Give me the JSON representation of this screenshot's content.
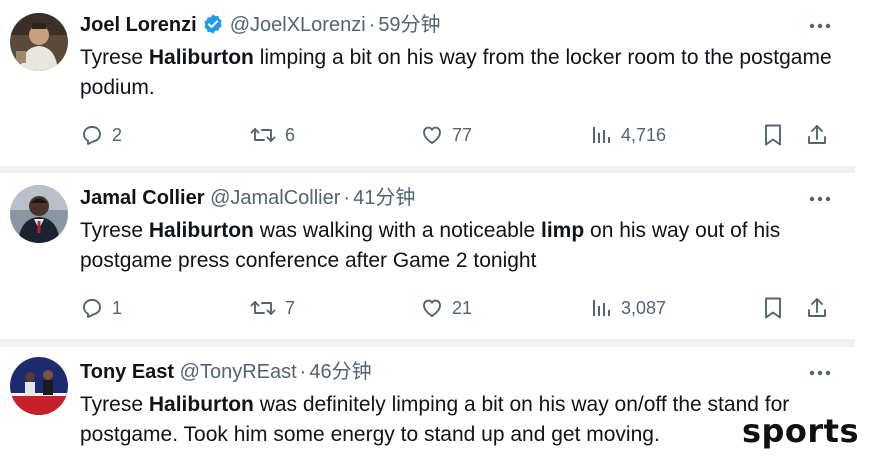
{
  "tweets": [
    {
      "name": "Joel Lorenzi",
      "verified": true,
      "handle": "@JoelXLorenzi",
      "separator": "·",
      "time": "59分钟",
      "text_parts": [
        {
          "t": "Tyrese ",
          "b": false
        },
        {
          "t": "Haliburton",
          "b": true
        },
        {
          "t": " limping a bit on his way from the locker room to the postgame podium.",
          "b": false
        }
      ],
      "replies": "2",
      "retweets": "6",
      "likes": "77",
      "views": "4,716"
    },
    {
      "name": "Jamal Collier",
      "verified": false,
      "handle": "@JamalCollier",
      "separator": "·",
      "time": "41分钟",
      "text_parts": [
        {
          "t": "Tyrese ",
          "b": false
        },
        {
          "t": "Haliburton",
          "b": true
        },
        {
          "t": " was walking with a noticeable ",
          "b": false
        },
        {
          "t": "limp",
          "b": true
        },
        {
          "t": " on his way out of his postgame press conference after Game 2 tonight",
          "b": false
        }
      ],
      "replies": "1",
      "retweets": "7",
      "likes": "21",
      "views": "3,087"
    },
    {
      "name": "Tony East",
      "verified": false,
      "handle": "@TonyREast",
      "separator": "·",
      "time": "46分钟",
      "text_parts": [
        {
          "t": "Tyrese ",
          "b": false
        },
        {
          "t": "Haliburton",
          "b": true
        },
        {
          "t": " was definitely limping a bit on his way on/off the stand for postgame. Took him some energy to stand up and get moving.",
          "b": false
        }
      ]
    }
  ],
  "watermark": "sports",
  "colors": {
    "verified": "#1d9bf0",
    "muted": "#536471",
    "separator": "#eff1f3"
  },
  "icons": [
    "more-icon",
    "reply-icon",
    "retweet-icon",
    "like-icon",
    "views-icon",
    "bookmark-icon",
    "share-icon",
    "verified-badge-icon"
  ]
}
